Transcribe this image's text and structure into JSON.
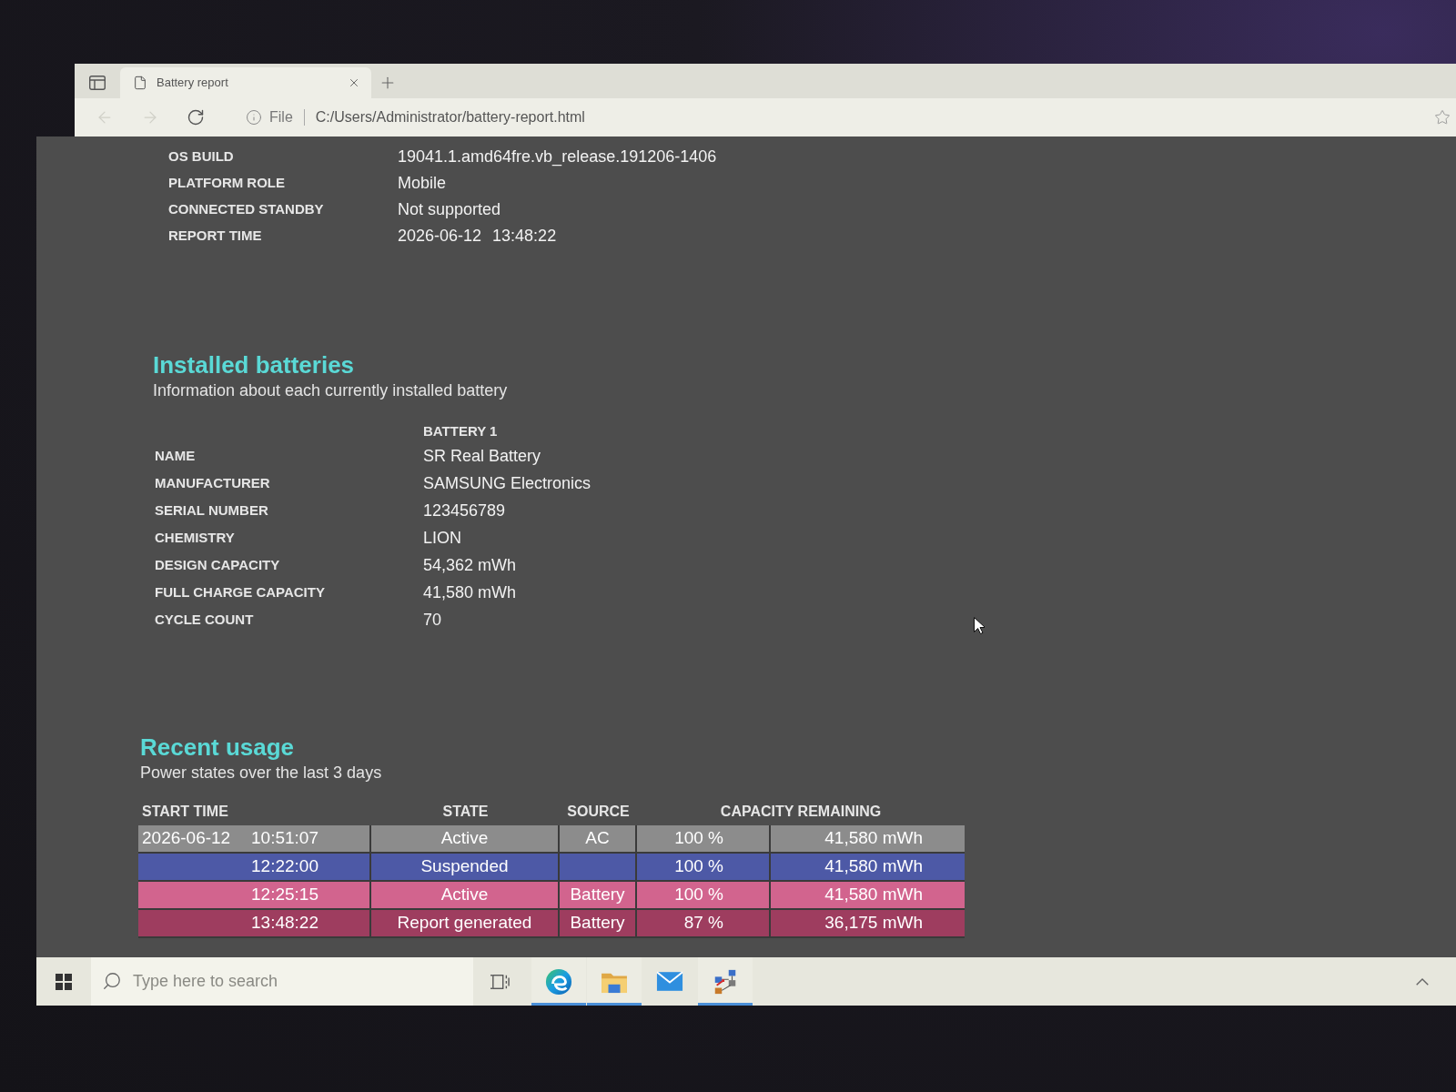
{
  "browser": {
    "tab": {
      "title": "Battery report"
    },
    "navigation": [
      {
        "kind": "back",
        "disabled": true
      },
      {
        "kind": "forward",
        "disabled": true
      },
      {
        "kind": "refresh",
        "disabled": false
      }
    ],
    "address_bar": {
      "scheme_label": "File",
      "url": "C:/Users/Administrator/battery-report.html"
    }
  },
  "system_info": [
    {
      "label": "OS BUILD",
      "value": "19041.1.amd64fre.vb_release.191206-1406"
    },
    {
      "label": "PLATFORM ROLE",
      "value": "Mobile"
    },
    {
      "label": "CONNECTED STANDBY",
      "value": "Not supported"
    },
    {
      "label": "REPORT TIME",
      "date": "2026-06-12",
      "time": "13:48:22"
    }
  ],
  "installed_batteries": {
    "title": "Installed batteries",
    "subtitle": "Information about each currently installed battery",
    "column_header": "BATTERY 1",
    "rows": [
      {
        "label": "NAME",
        "value": "SR Real Battery"
      },
      {
        "label": "MANUFACTURER",
        "value": "SAMSUNG Electronics"
      },
      {
        "label": "SERIAL NUMBER",
        "value": "123456789"
      },
      {
        "label": "CHEMISTRY",
        "value": "LION"
      },
      {
        "label": "DESIGN CAPACITY",
        "value": "54,362 mWh"
      },
      {
        "label": "FULL CHARGE CAPACITY",
        "value": "41,580 mWh"
      },
      {
        "label": "CYCLE COUNT",
        "value": "70"
      }
    ]
  },
  "recent_usage": {
    "title": "Recent usage",
    "subtitle": "Power states over the last 3 days",
    "columns": [
      "START TIME",
      "STATE",
      "SOURCE",
      "CAPACITY REMAINING"
    ],
    "rows": [
      {
        "date": "2026-06-12",
        "time": "10:51:07",
        "state": "Active",
        "source": "AC",
        "percent": "100 %",
        "energy": "41,580 mWh",
        "color": "#8c8c8c"
      },
      {
        "time": "12:22:00",
        "state": "Suspended",
        "percent": "100 %",
        "energy": "41,580 mWh",
        "color": "#4d59a6"
      },
      {
        "time": "12:25:15",
        "state": "Active",
        "source": "Battery",
        "percent": "100 %",
        "energy": "41,580 mWh",
        "color": "#d2648e"
      },
      {
        "time": "13:48:22",
        "state": "Report generated",
        "source": "Battery",
        "percent": "87 %",
        "energy": "36,175 mWh",
        "color": "#9e3d5f"
      }
    ]
  },
  "taskbar": {
    "search_placeholder": "Type here to search",
    "apps": [
      {
        "kind": "swirl",
        "running": true
      },
      {
        "kind": "folder",
        "running": true
      },
      {
        "kind": "mail",
        "running": false
      },
      {
        "kind": "network",
        "running": true
      }
    ]
  }
}
